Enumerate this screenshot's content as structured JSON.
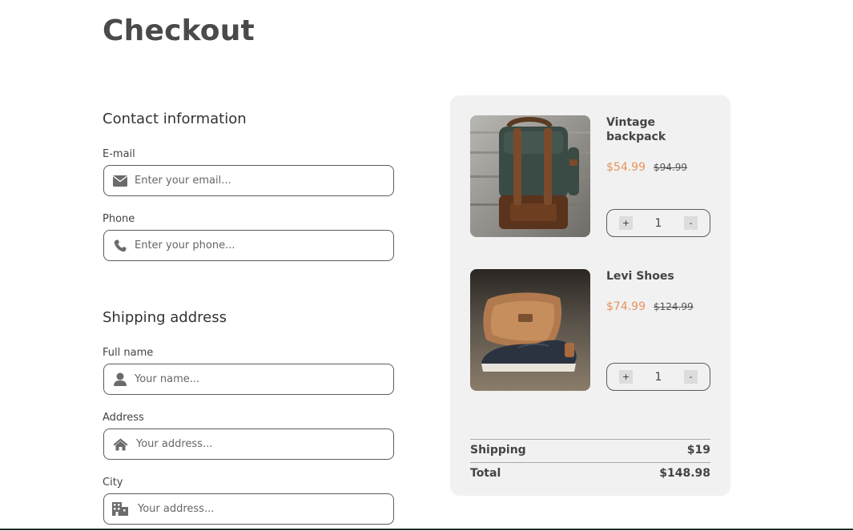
{
  "page": {
    "title": "Checkout"
  },
  "contact": {
    "heading": "Contact information",
    "email": {
      "label": "E-mail",
      "placeholder": "Enter your email...",
      "icon": "envelope-icon"
    },
    "phone": {
      "label": "Phone",
      "placeholder": "Enter your phone...",
      "icon": "phone-icon"
    }
  },
  "shipping": {
    "heading": "Shipping address",
    "full_name": {
      "label": "Full name",
      "placeholder": "Your name...",
      "icon": "user-icon"
    },
    "address": {
      "label": "Address",
      "placeholder": "Your address...",
      "icon": "home-icon"
    },
    "city": {
      "label": "City",
      "placeholder": "Your address...",
      "icon": "city-icon"
    }
  },
  "cart": {
    "items": [
      {
        "name": "Vintage backpack",
        "price": "$54.99",
        "old_price": "$94.99",
        "qty": "1",
        "plus": "+",
        "minus": "-"
      },
      {
        "name": "Levi Shoes",
        "price": "$74.99",
        "old_price": "$124.99",
        "qty": "1",
        "plus": "+",
        "minus": "-"
      }
    ],
    "shipping_label": "Shipping",
    "shipping_value": "$19",
    "total_label": "Total",
    "total_value": "$148.98"
  },
  "colors": {
    "accent_price": "#e8925a",
    "panel_bg": "#f1f1f1",
    "border": "#5c5c5c"
  }
}
